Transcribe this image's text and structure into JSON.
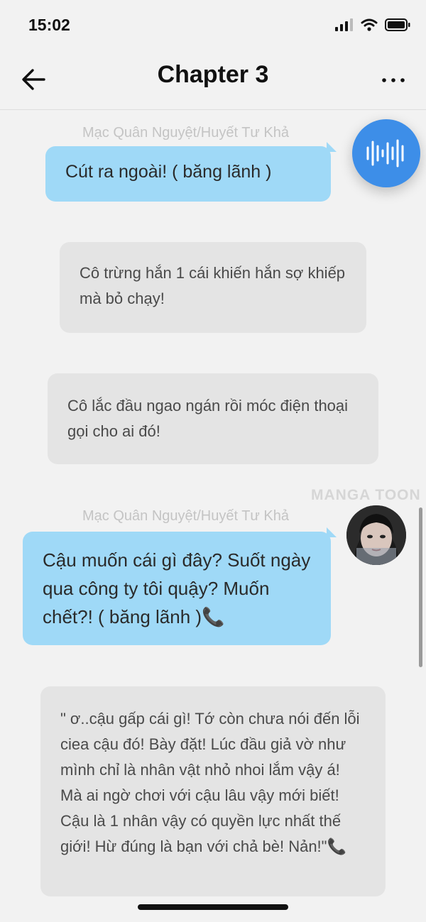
{
  "status_bar": {
    "time": "15:02"
  },
  "nav": {
    "title": "Chapter 3"
  },
  "messages": [
    {
      "sender": "Mạc Quân Nguyệt/Huyết Tư Khả",
      "text": "Cút ra ngoài! ( băng lãnh )"
    },
    {
      "narration": "Cô trừng hắn 1 cái khiến hắn sợ khiếp mà bỏ chạy!"
    },
    {
      "narration": "Cô lắc đầu ngao ngán rồi móc điện thoại gọi cho ai đó!"
    },
    {
      "sender": "Mạc Quân Nguyệt/Huyết Tư Khả",
      "text": "Cậu muốn cái gì đây? Suốt ngày qua công ty tôi quậy? Muốn chết?! ( băng lãnh )📞"
    },
    {
      "narration": "\" ơ..cậu gấp cái gì! Tớ còn chưa nói đến lỗi ciea cậu đó! Bày đặt! Lúc đầu giả vờ như mình chỉ là nhân vật nhỏ nhoi lắm vậy á! Mà ai ngờ chơi với cậu lâu vậy mới biết! Cậu là 1 nhân vậy có quyền lực nhất thế giới! Hừ đúng là bạn với chả bè! Nản!\"📞"
    }
  ],
  "watermark": "MANGA TOON",
  "icons": {
    "back": "arrow-left-icon",
    "more": "more-horizontal-icon",
    "audio": "sound-wave-icon",
    "signal": "signal-icon",
    "wifi": "wifi-icon",
    "battery": "battery-icon"
  },
  "colors": {
    "bubble": "#9fd9f7",
    "narration": "#e4e4e4",
    "audio_button": "#3d8ee8",
    "background": "#f2f2f2"
  }
}
